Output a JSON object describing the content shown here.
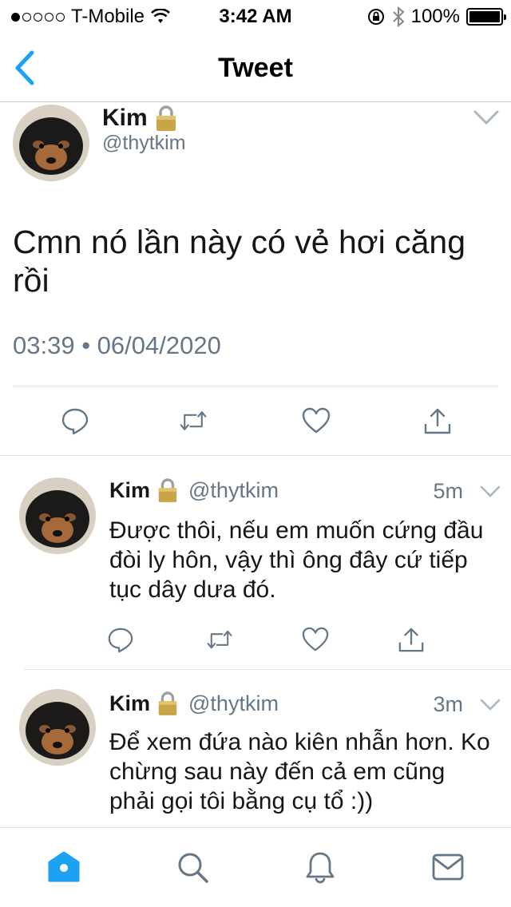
{
  "status_bar": {
    "carrier": "T-Mobile",
    "time": "3:42 AM",
    "battery": "100%",
    "signal_bars_on": 1,
    "signal_bars_total": 5
  },
  "nav": {
    "title": "Tweet",
    "back_icon": "chevron-left-icon"
  },
  "main_tweet": {
    "name": "Kim",
    "handle": "@thytkim",
    "text": "Cmn nó lần này có vẻ hơi căng rồi",
    "timestamp": "03:39 • 06/04/2020",
    "actions": [
      "reply-icon",
      "retweet-icon",
      "like-icon",
      "share-icon"
    ]
  },
  "replies": [
    {
      "name": "Kim",
      "handle": "@thytkim",
      "time": "5m",
      "text": "Được thôi, nếu em muốn cứng đầu đòi ly hôn, vậy thì ông đây cứ tiếp tục dây dưa đó."
    },
    {
      "name": "Kim",
      "handle": "@thytkim",
      "time": "3m",
      "text": "Để xem đứa nào kiên nhẫn hơn. Ko chừng sau này đến cả em cũng phải gọi tôi bằng cụ tổ :))"
    }
  ],
  "tab_bar": {
    "tabs": [
      "home-icon",
      "search-icon",
      "notifications-icon",
      "messages-icon"
    ],
    "active": "home-icon"
  },
  "colors": {
    "accent": "#1da1f2",
    "secondary_text": "#657786",
    "primary_text": "#14171a",
    "divider": "#dfe3e6",
    "lock": "#c9a548"
  }
}
